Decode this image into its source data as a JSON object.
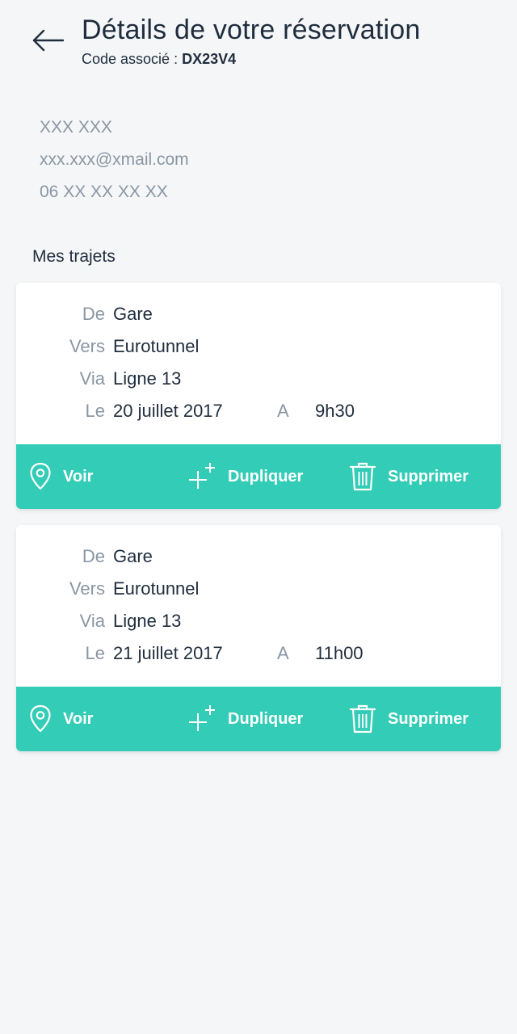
{
  "header": {
    "title": "Détails de votre réservation",
    "code_label": "Code associé :",
    "code_value": "DX23V4"
  },
  "contact": {
    "name": "XXX XXX",
    "email": "xxx.xxx@xmail.com",
    "phone": "06 XX XX XX XX"
  },
  "section_title": "Mes trajets",
  "labels": {
    "from": "De",
    "to": "Vers",
    "via": "Via",
    "date": "Le",
    "at": "A"
  },
  "actions": {
    "view": "Voir",
    "duplicate": "Dupliquer",
    "delete": "Supprimer"
  },
  "trips": [
    {
      "from": "Gare",
      "to": "Eurotunnel",
      "via": "Ligne 13",
      "date": "20 juillet 2017",
      "time": "9h30"
    },
    {
      "from": "Gare",
      "to": "Eurotunnel",
      "via": "Ligne 13",
      "date": "21 juillet 2017",
      "time": "11h00"
    }
  ],
  "colors": {
    "accent": "#33ccb6",
    "background": "#f5f6f8",
    "text": "#1f2d3d",
    "muted": "#8a96a3"
  }
}
